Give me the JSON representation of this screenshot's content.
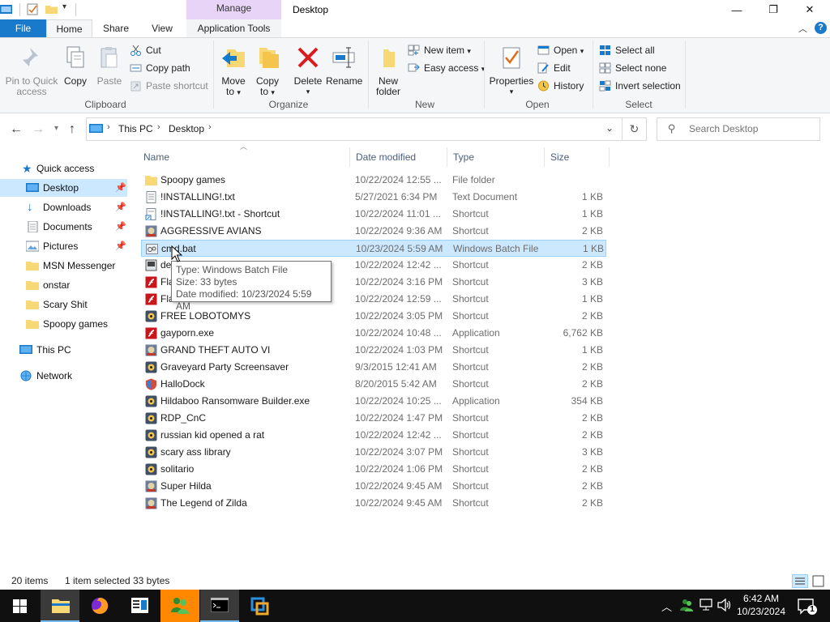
{
  "titlebar": {
    "manage": "Manage",
    "title": "Desktop",
    "minimize": "—",
    "maximize": "❐",
    "close": "✕"
  },
  "tabs": {
    "file": "File",
    "home": "Home",
    "share": "Share",
    "view": "View",
    "app_tools": "Application Tools"
  },
  "ribbon": {
    "clipboard": {
      "label": "Clipboard",
      "pin_line1": "Pin to Quick",
      "pin_line2": "access",
      "copy": "Copy",
      "paste": "Paste",
      "cut": "Cut",
      "copy_path": "Copy path",
      "paste_shortcut": "Paste shortcut"
    },
    "organize": {
      "label": "Organize",
      "move_line1": "Move",
      "move_line2": "to",
      "copy_line1": "Copy",
      "copy_line2": "to",
      "delete_line1": "Delete",
      "rename": "Rename"
    },
    "new": {
      "label": "New",
      "new_folder_line1": "New",
      "new_folder_line2": "folder",
      "new_item": "New item",
      "easy_access": "Easy access"
    },
    "open": {
      "label": "Open",
      "properties": "Properties",
      "open": "Open",
      "edit": "Edit",
      "history": "History"
    },
    "select": {
      "label": "Select",
      "select_all": "Select all",
      "select_none": "Select none",
      "invert": "Invert selection"
    }
  },
  "address": {
    "crumb1": "This PC",
    "crumb2": "Desktop",
    "search_placeholder": "Search Desktop"
  },
  "navpane": {
    "quick_access": "Quick access",
    "items": [
      {
        "label": "Desktop"
      },
      {
        "label": "Downloads"
      },
      {
        "label": "Documents"
      },
      {
        "label": "Pictures"
      },
      {
        "label": "MSN Messenger"
      },
      {
        "label": "onstar"
      },
      {
        "label": "Scary Shit"
      },
      {
        "label": "Spoopy games"
      }
    ],
    "this_pc": "This PC",
    "network": "Network"
  },
  "columns": {
    "name": "Name",
    "date": "Date modified",
    "type": "Type",
    "size": "Size"
  },
  "files": [
    {
      "name": "Spoopy games",
      "date": "10/22/2024 12:55 ...",
      "type": "File folder",
      "size": "",
      "icon": "folder-icon"
    },
    {
      "name": "!INSTALLING!.txt",
      "date": "5/27/2021 6:34 PM",
      "type": "Text Document",
      "size": "1 KB",
      "icon": "text-file-icon"
    },
    {
      "name": "!INSTALLING!.txt - Shortcut",
      "date": "10/22/2024 11:01 ...",
      "type": "Shortcut",
      "size": "1 KB",
      "icon": "shortcut-file-icon"
    },
    {
      "name": "AGGRESSIVE AVIANS",
      "date": "10/22/2024 9:36 AM",
      "type": "Shortcut",
      "size": "2 KB",
      "icon": "game-icon"
    },
    {
      "name": "cmd.bat",
      "date": "10/23/2024 5:59 AM",
      "type": "Windows Batch File",
      "size": "1 KB",
      "icon": "batch-file-icon"
    },
    {
      "name": "de",
      "date": "10/22/2024 12:42 ...",
      "type": "Shortcut",
      "size": "2 KB",
      "icon": "shortcut-icon"
    },
    {
      "name": "Fla",
      "date": "10/22/2024 3:16 PM",
      "type": "Shortcut",
      "size": "3 KB",
      "icon": "flash-icon"
    },
    {
      "name": "Fla",
      "date": "10/22/2024 12:59 ...",
      "type": "Shortcut",
      "size": "1 KB",
      "icon": "flash-icon"
    },
    {
      "name": "FREE LOBOTOMYS",
      "date": "10/22/2024 3:05 PM",
      "type": "Shortcut",
      "size": "2 KB",
      "icon": "app-icon"
    },
    {
      "name": "gayporn.exe",
      "date": "10/22/2024 10:48 ...",
      "type": "Application",
      "size": "6,762 KB",
      "icon": "flash-icon"
    },
    {
      "name": "GRAND THEFT AUTO VI",
      "date": "10/22/2024 1:03 PM",
      "type": "Shortcut",
      "size": "1 KB",
      "icon": "game-icon"
    },
    {
      "name": "Graveyard Party Screensaver",
      "date": "9/3/2015 12:41 AM",
      "type": "Shortcut",
      "size": "2 KB",
      "icon": "app-icon"
    },
    {
      "name": "HalloDock",
      "date": "8/20/2015 5:42 AM",
      "type": "Shortcut",
      "size": "2 KB",
      "icon": "shield-icon"
    },
    {
      "name": "Hildaboo Ransomware Builder.exe",
      "date": "10/22/2024 10:25 ...",
      "type": "Application",
      "size": "354 KB",
      "icon": "app-icon"
    },
    {
      "name": "RDP_CnC",
      "date": "10/22/2024 1:47 PM",
      "type": "Shortcut",
      "size": "2 KB",
      "icon": "app-icon"
    },
    {
      "name": "russian kid opened a rat",
      "date": "10/22/2024 12:42 ...",
      "type": "Shortcut",
      "size": "2 KB",
      "icon": "app-icon"
    },
    {
      "name": "scary ass library",
      "date": "10/22/2024 3:07 PM",
      "type": "Shortcut",
      "size": "3 KB",
      "icon": "app-icon"
    },
    {
      "name": "solitario",
      "date": "10/22/2024 1:06 PM",
      "type": "Shortcut",
      "size": "2 KB",
      "icon": "app-icon"
    },
    {
      "name": "Super Hilda",
      "date": "10/22/2024 9:45 AM",
      "type": "Shortcut",
      "size": "2 KB",
      "icon": "game-icon"
    },
    {
      "name": "The Legend of Zilda",
      "date": "10/22/2024 9:45 AM",
      "type": "Shortcut",
      "size": "2 KB",
      "icon": "game-icon"
    }
  ],
  "tooltip": {
    "line1": "Type: Windows Batch File",
    "line2": "Size: 33 bytes",
    "line3": "Date modified: 10/23/2024 5:59 AM"
  },
  "status": {
    "count": "20 items",
    "selected": "1 item selected",
    "size": "33 bytes"
  },
  "taskbar": {
    "time": "6:42 AM",
    "date": "10/23/2024",
    "notif_count": "1"
  },
  "colors": {
    "accent": "#1979ca",
    "selection": "#cce8ff",
    "manage_tab": "#e8d4f7",
    "taskbar": "#101010"
  }
}
